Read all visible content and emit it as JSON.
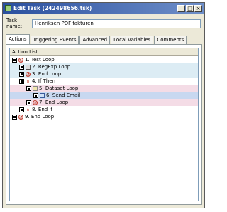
{
  "window": {
    "title": "Edit Task (242498656.tsk)",
    "controls": {
      "minimize": "_",
      "maximize": "□",
      "close": "×"
    }
  },
  "task_name": {
    "label": "Task name:",
    "value": "Henriksen PDF fakturen"
  },
  "tabs": [
    {
      "label": "Actions",
      "active": true
    },
    {
      "label": "Triggering Events",
      "active": false
    },
    {
      "label": "Advanced",
      "active": false
    },
    {
      "label": "Local variables",
      "active": false
    },
    {
      "label": "Comments",
      "active": false
    }
  ],
  "action_list": {
    "header": "Action List",
    "rows": [
      {
        "label": "1. Test Loop",
        "icon": "loop-icon"
      },
      {
        "label": "2. RegExp Loop",
        "icon": "regex-icon"
      },
      {
        "label": "3. End Loop",
        "icon": "end-loop-icon"
      },
      {
        "label": "4. If Then",
        "icon": "if-then-icon"
      },
      {
        "label": "5. Dataset Loop",
        "icon": "dataset-icon"
      },
      {
        "label": "6. Send Email",
        "icon": "email-icon"
      },
      {
        "label": "7. End Loop",
        "icon": "end-loop-icon"
      },
      {
        "label": "8. End If",
        "icon": "end-if-icon"
      },
      {
        "label": "9. End Loop",
        "icon": "end-loop-icon"
      }
    ]
  },
  "colors": {
    "titlebar": "#2a4f9e",
    "row_blue": "#dcecf4",
    "row_pink": "#f4dce6",
    "row_selected": "#c8d8f0"
  }
}
